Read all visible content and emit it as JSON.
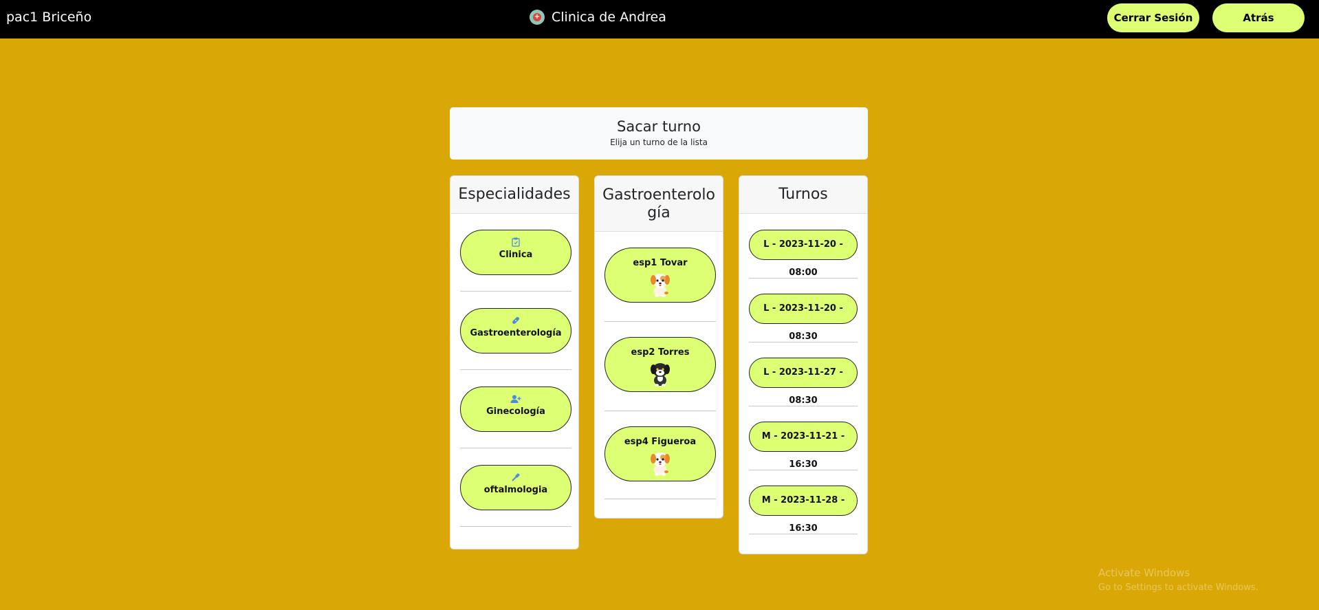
{
  "topbar": {
    "user_name": "pac1 Briceño",
    "brand": "Clinica de Andrea",
    "logout_label": "Cerrar Sesión",
    "back_label": "Atrás"
  },
  "header": {
    "title": "Sacar turno",
    "subtitle": "Elija un turno de la lista"
  },
  "especialidades": {
    "title": "Especialidades",
    "items": [
      {
        "label": "Clinica",
        "icon": "clipboard-icon"
      },
      {
        "label": "Gastroenterología",
        "icon": "bandage-icon"
      },
      {
        "label": "Ginecología",
        "icon": "user-plus-icon"
      },
      {
        "label": "oftalmologia",
        "icon": "dropper-icon"
      }
    ]
  },
  "especialistas": {
    "title": "Gastroenterología",
    "items": [
      {
        "label": "esp1 Tovar",
        "avatar": "puppy-orange"
      },
      {
        "label": "esp2 Torres",
        "avatar": "puppy-black"
      },
      {
        "label": "esp4 Figueroa",
        "avatar": "puppy-orange"
      }
    ]
  },
  "turnos": {
    "title": "Turnos",
    "items": [
      {
        "label": "L - 2023-11-20 - 08:00"
      },
      {
        "label": "L - 2023-11-20 - 08:30"
      },
      {
        "label": "L - 2023-11-27 - 08:30"
      },
      {
        "label": "M - 2023-11-21 - 16:30"
      },
      {
        "label": "M - 2023-11-28 - 16:30"
      }
    ]
  },
  "watermark": {
    "line1": "Activate Windows",
    "line2": "Go to Settings to activate Windows."
  },
  "colors": {
    "background": "#daa806",
    "topbar": "#000000",
    "pill": "#ddff73",
    "icon_blue": "#4a8be0"
  }
}
